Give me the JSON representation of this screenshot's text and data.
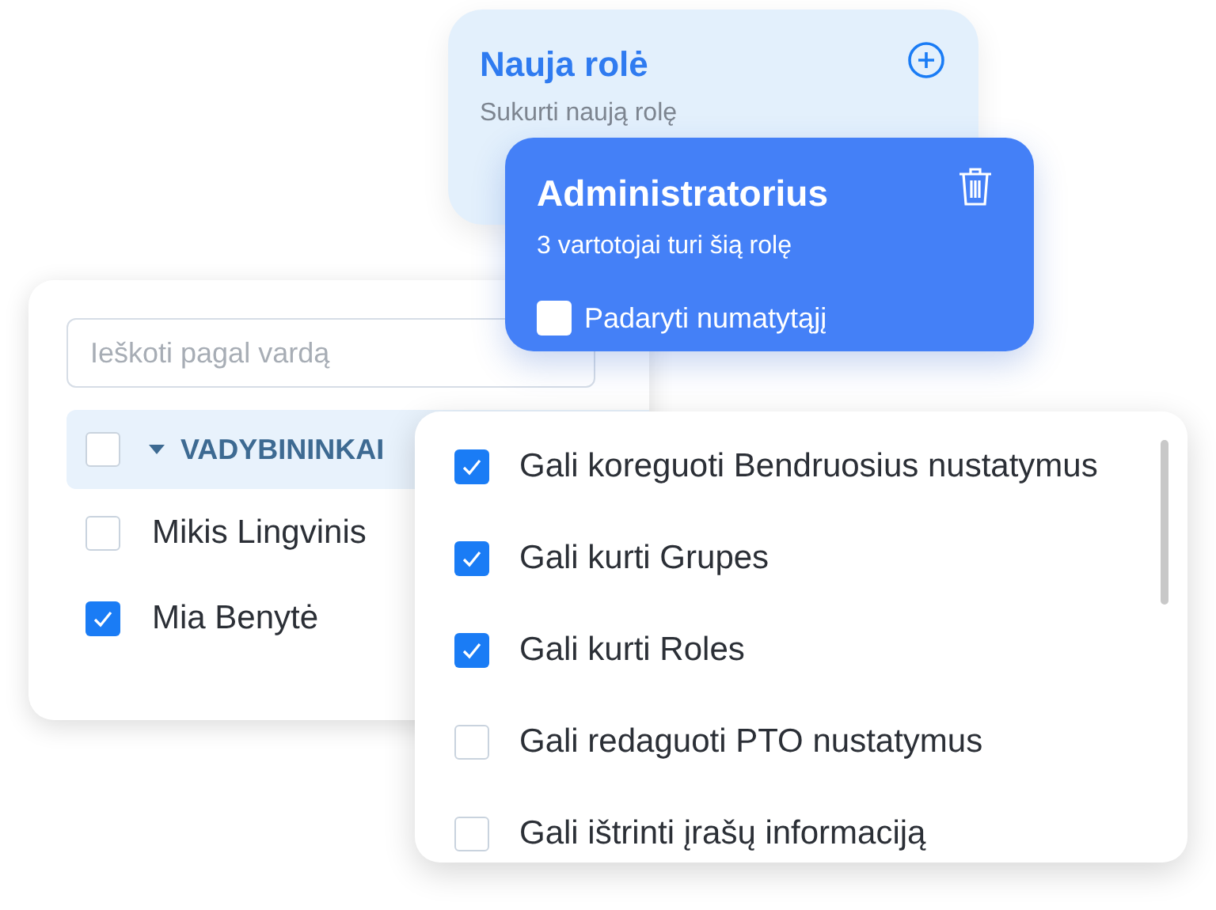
{
  "new_role_card": {
    "title": "Nauja rolė",
    "subtitle": "Sukurti naują rolę"
  },
  "role_card": {
    "title": "Administratorius",
    "subtitle": "3 vartotojai turi šią rolę",
    "default_checkbox": {
      "label": "Padaryti numatytąjį",
      "checked": false
    }
  },
  "users_panel": {
    "search": {
      "placeholder": "Ieškoti pagal vardą"
    },
    "group": {
      "label": "VADYBININKAI",
      "checked": false,
      "expanded": true
    },
    "users": [
      {
        "name": "Mikis Lingvinis",
        "checked": false
      },
      {
        "name": "Mia Benytė",
        "checked": true
      }
    ]
  },
  "permissions": [
    {
      "label": "Gali koreguoti Bendruosius nustatymus",
      "checked": true
    },
    {
      "label": "Gali kurti Grupes",
      "checked": true
    },
    {
      "label": "Gali kurti Roles",
      "checked": true
    },
    {
      "label": "Gali redaguoti PTO nustatymus",
      "checked": false
    },
    {
      "label": "Gali ištrinti įrašų informaciją",
      "checked": false
    }
  ]
}
